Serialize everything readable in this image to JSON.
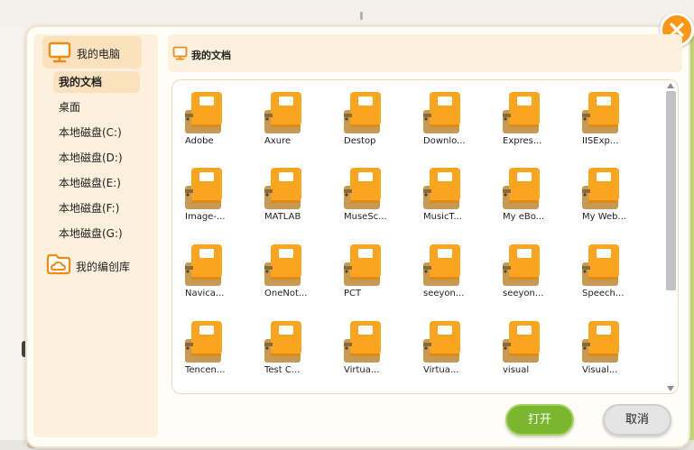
{
  "sidebar": {
    "computer_label": "我的电脑",
    "items": [
      {
        "label": "我的文档"
      },
      {
        "label": "桌面"
      },
      {
        "label": "本地磁盘(C:)"
      },
      {
        "label": "本地磁盘(D:)"
      },
      {
        "label": "本地磁盘(E:)"
      },
      {
        "label": "本地磁盘(F:)"
      },
      {
        "label": "本地磁盘(G:)"
      }
    ],
    "library_label": "我的编创库"
  },
  "header": {
    "path_label": "我的文档"
  },
  "files": [
    "Adobe",
    "Axure",
    "Destop",
    "Downlo...",
    "Expres...",
    "IISExp...",
    "Image-...",
    "MATLAB",
    "MuseSc...",
    "MusicT...",
    "My eBo...",
    "My Web...",
    "Navica...",
    "OneNot...",
    "PCT",
    "seeyon...",
    "seeyon...",
    "Speech...",
    "Tencen...",
    "Test C...",
    "Virtua...",
    "Virtua...",
    "visual",
    "Visual..."
  ],
  "buttons": {
    "open": "打开",
    "cancel": "取消"
  },
  "icons": {
    "close": "close-icon",
    "computer": "computer-icon",
    "library": "cloud-folder-icon",
    "file": "folder-book-icon"
  },
  "colors": {
    "accent_orange": "#ff9616",
    "sidebar_bg": "#fdf0dc",
    "selected_bg": "#fbe2bf",
    "open_green": "#7ab72e",
    "folder_orange": "#f9a51f",
    "folder_tan": "#c69a55"
  }
}
